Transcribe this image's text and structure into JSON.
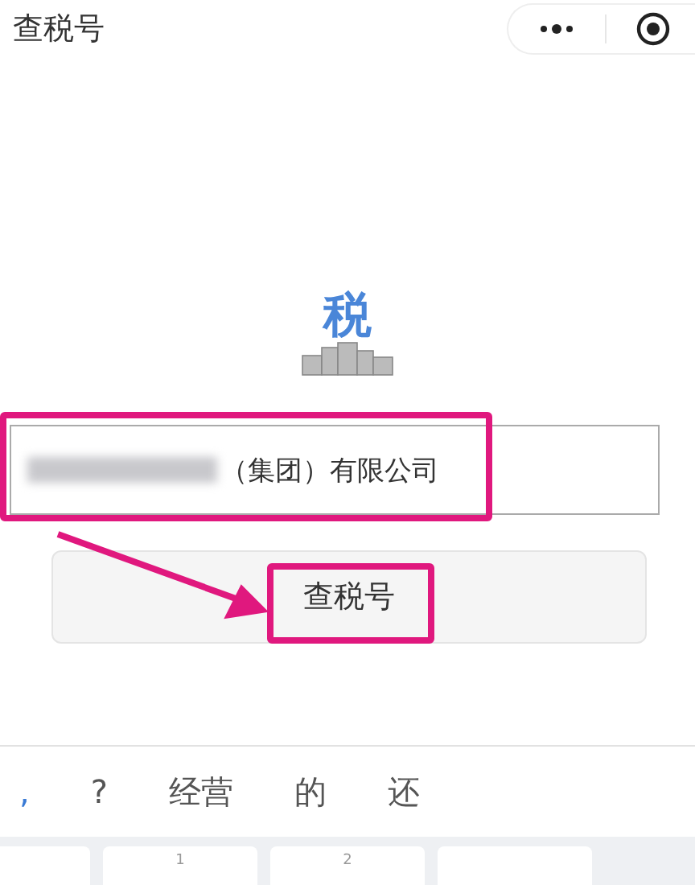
{
  "header": {
    "title": "查税号"
  },
  "logo": {
    "text": "税"
  },
  "search": {
    "value": "（集团）有限公司",
    "redacted": true
  },
  "button": {
    "label": "查税号"
  },
  "annotations": {
    "highlight_field": true,
    "highlight_button": true,
    "arrow": true
  },
  "keyboard": {
    "candidates": [
      ",",
      "?",
      "经营",
      "的",
      "还"
    ],
    "keys": [
      {
        "kind": "blank"
      },
      {
        "kind": "digit",
        "label": "1"
      },
      {
        "kind": "digit",
        "label": "2"
      },
      {
        "kind": "blank"
      }
    ]
  }
}
